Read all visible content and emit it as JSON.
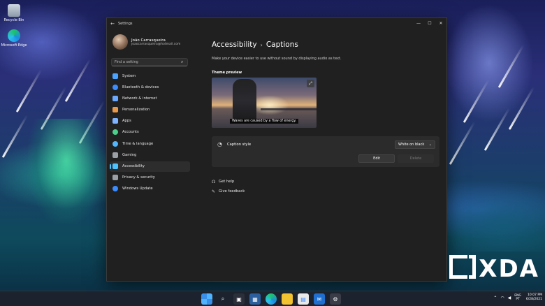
{
  "desktop": {
    "icons": [
      {
        "label": "Recycle Bin",
        "icon": "recycle-bin-icon"
      },
      {
        "label": "Microsoft Edge",
        "icon": "edge-icon"
      }
    ]
  },
  "window": {
    "app_title": "Settings",
    "controls": {
      "minimize": "—",
      "maximize": "☐",
      "close": "✕"
    }
  },
  "profile": {
    "name": "João Carrasqueira",
    "email": "joaocarrasqueira@hotmail.com"
  },
  "search": {
    "placeholder": "Find a setting"
  },
  "sidebar": {
    "items": [
      {
        "label": "System",
        "icon": "system-icon",
        "color": "#4aa3ff"
      },
      {
        "label": "Bluetooth & devices",
        "icon": "bluetooth-icon",
        "color": "#3b8cff"
      },
      {
        "label": "Network & internet",
        "icon": "network-icon",
        "color": "#6aa9ff"
      },
      {
        "label": "Personalization",
        "icon": "brush-icon",
        "color": "#e8984a"
      },
      {
        "label": "Apps",
        "icon": "apps-icon",
        "color": "#7fb3ff"
      },
      {
        "label": "Accounts",
        "icon": "accounts-icon",
        "color": "#4ccf8a"
      },
      {
        "label": "Time & language",
        "icon": "clock-icon",
        "color": "#52b6ff"
      },
      {
        "label": "Gaming",
        "icon": "gaming-icon",
        "color": "#9aa0a6"
      },
      {
        "label": "Accessibility",
        "icon": "accessibility-icon",
        "color": "#4cc2ff"
      },
      {
        "label": "Privacy & security",
        "icon": "shield-icon",
        "color": "#9aa0a6"
      },
      {
        "label": "Windows Update",
        "icon": "update-icon",
        "color": "#3b8cff"
      }
    ],
    "active_index": 8
  },
  "main": {
    "breadcrumb_parent": "Accessibility",
    "breadcrumb_sep": "›",
    "breadcrumb_current": "Captions",
    "subtitle": "Make your device easier to use without sound by displaying audio as text.",
    "theme_preview_label": "Theme preview",
    "preview_caption": "Waves are caused by a flow of energy.",
    "caption_style_label": "Caption style",
    "caption_style_value": "White on black",
    "edit_label": "Edit",
    "delete_label": "Delete",
    "get_help": "Get help",
    "give_feedback": "Give feedback"
  },
  "taskbar": {
    "apps": [
      "start-icon",
      "search-icon",
      "task-view-icon",
      "widgets-icon",
      "edge-icon",
      "file-explorer-icon",
      "store-icon",
      "mail-icon",
      "settings-icon"
    ],
    "lang_top": "ENG",
    "lang_bottom": "PT",
    "time": "10:07 PM",
    "date": "6/28/2021"
  },
  "watermark": "XDA",
  "colors": {
    "accent": "#4cc2ff",
    "window_bg": "#202020",
    "card_bg": "#2b2b2b"
  }
}
